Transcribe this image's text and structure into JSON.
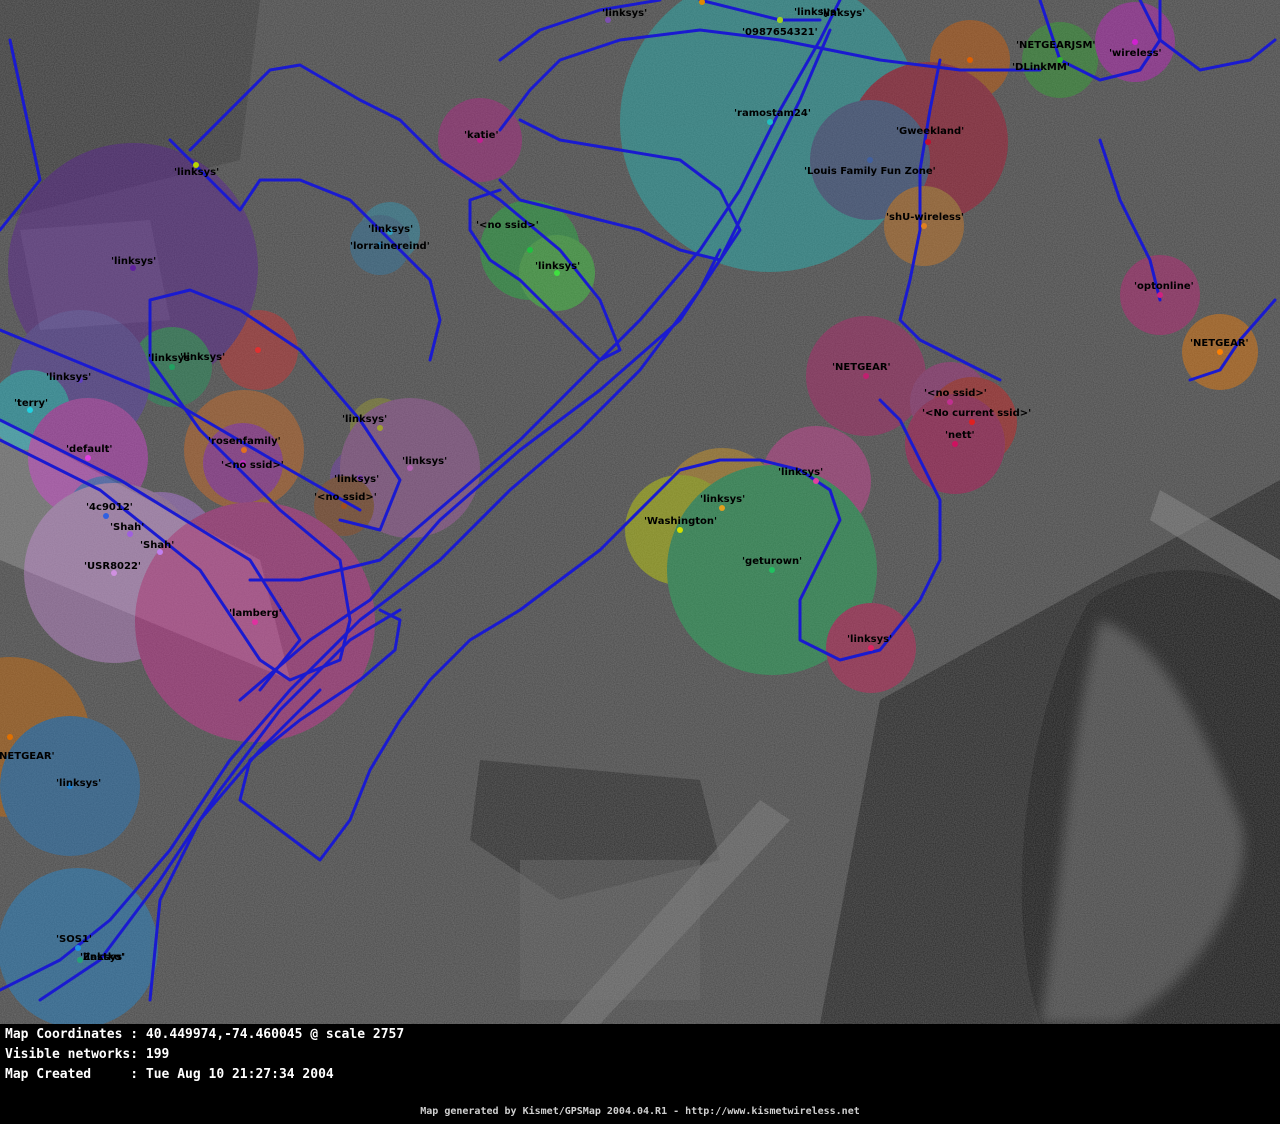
{
  "map": {
    "coordinates_label": "Map Coordinates",
    "coordinates_value": "40.449974,-74.460045 @ scale 2757",
    "visible_label": "Visible networks",
    "visible_value": "199",
    "created_label": "Map Created",
    "created_value": "Tue Aug 10 21:27:34 2004",
    "footer": "Map generated by Kismet/GPSMap 2004.04.R1 - http://www.kismetwireless.net"
  },
  "colors": {
    "track": "#1a1ad0",
    "background": "#000000",
    "text": "#ffffff"
  },
  "networks": [
    {
      "ssid": "'linksys'",
      "color": "#7b4fb0"
    },
    {
      "ssid": "'linksys'",
      "color": "#b7d400"
    },
    {
      "ssid": "'0987654321'",
      "color": "#d9e000"
    },
    {
      "ssid": "'linksys'",
      "color": "#e08a00"
    },
    {
      "ssid": "'NETGEARJSM'",
      "color": "#e06000"
    },
    {
      "ssid": "'DLinkMM'",
      "color": "#30b030"
    },
    {
      "ssid": "'wireless'",
      "color": "#d020d0"
    },
    {
      "ssid": "'linksys'",
      "color": "#e03030"
    },
    {
      "ssid": "'katie'",
      "color": "#c02090"
    },
    {
      "ssid": "'ramostam24'",
      "color": "#20c0c0"
    },
    {
      "ssid": "'Gweekland'",
      "color": "#c01030"
    },
    {
      "ssid": "'Louis Family Fun Zone'",
      "color": "#4060a0"
    },
    {
      "ssid": "'linksys'",
      "color": "#a0d020"
    },
    {
      "ssid": "'shU-wireless'",
      "color": "#e08020"
    },
    {
      "ssid": "'linksys'",
      "color": "#30a0c0"
    },
    {
      "ssid": "'lorrainereind'",
      "color": "#3080b0"
    },
    {
      "ssid": "'<no ssid>'",
      "color": "#20c040"
    },
    {
      "ssid": "'linksys'",
      "color": "#40e040"
    },
    {
      "ssid": "'linksys'",
      "color": "#6020a0"
    },
    {
      "ssid": "'optonline'",
      "color": "#d02080"
    },
    {
      "ssid": "'NETGEAR'",
      "color": "#ff8000"
    },
    {
      "ssid": "'linksys'",
      "color": "#20a060"
    },
    {
      "ssid": "'linksys'",
      "color": "#6040c0"
    },
    {
      "ssid": "'terry'",
      "color": "#20d0e0"
    },
    {
      "ssid": "'NETGEAR'",
      "color": "#c02070"
    },
    {
      "ssid": "'<no ssid>'",
      "color": "#c03090"
    },
    {
      "ssid": "'<No current ssid>'",
      "color": "#e02020"
    },
    {
      "ssid": "'nett'",
      "color": "#d01060"
    },
    {
      "ssid": "'linksys'",
      "color": "#a0a030"
    },
    {
      "ssid": "'rosenfamily'",
      "color": "#e07020"
    },
    {
      "ssid": "'<no ssid>'",
      "color": "#c030c0"
    },
    {
      "ssid": "'default'",
      "color": "#e040e0"
    },
    {
      "ssid": "'linksys'",
      "color": "#8040c0"
    },
    {
      "ssid": "'linksys'",
      "color": "#b060b0"
    },
    {
      "ssid": "'<no ssid>'",
      "color": "#a05020"
    },
    {
      "ssid": "'linksys'",
      "color": "#e040a0"
    },
    {
      "ssid": "'4c9012'",
      "color": "#3060e0"
    },
    {
      "ssid": "'Shah'",
      "color": "#a060e0"
    },
    {
      "ssid": "'Shah'",
      "color": "#c080f0"
    },
    {
      "ssid": "'USR8022'",
      "color": "#d090e0"
    },
    {
      "ssid": "'linksys'",
      "color": "#e0a020"
    },
    {
      "ssid": "'Washington'",
      "color": "#d0e000"
    },
    {
      "ssid": "'geturown'",
      "color": "#20c060"
    },
    {
      "ssid": "'lamberg'",
      "color": "#e030a0"
    },
    {
      "ssid": "'linksys'",
      "color": "#e02060"
    },
    {
      "ssid": "'NETGEAR'",
      "color": "#e07000"
    },
    {
      "ssid": "'linksys'",
      "color": "#2080d0"
    },
    {
      "ssid": "'SOS1'",
      "color": "#2090e0"
    },
    {
      "ssid": "'Zastko'",
      "color": "#e08000"
    },
    {
      "ssid": "'linksys'",
      "color": "#20a080"
    }
  ]
}
